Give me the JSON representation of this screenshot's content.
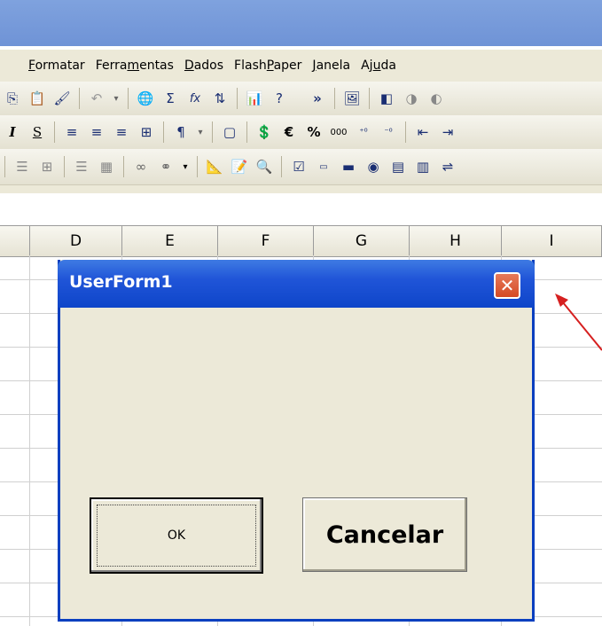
{
  "menu": {
    "items": [
      {
        "pre": "",
        "u": "F",
        "post": "ormatar"
      },
      {
        "pre": "Ferra",
        "u": "m",
        "post": "entas"
      },
      {
        "pre": "",
        "u": "D",
        "post": "ados"
      },
      {
        "pre": "Flash",
        "u": "P",
        "post": "aper"
      },
      {
        "pre": "",
        "u": "J",
        "post": "anela"
      },
      {
        "pre": "Aj",
        "u": "u",
        "post": "da"
      }
    ]
  },
  "toolbar": {
    "sigma": "Σ",
    "fx": "fx",
    "euro": "€",
    "percent": "%",
    "thousands": "000",
    "bold_i": "I",
    "underline_s": "S",
    "overflow": "»"
  },
  "columns": [
    "D",
    "E",
    "F",
    "G",
    "H",
    "I"
  ],
  "dialog": {
    "title": "UserForm1",
    "close_glyph": "✕",
    "ok_label": "OK",
    "cancel_label": "Cancelar"
  },
  "colors": {
    "dialog_title": "#1e4fd6",
    "arrow": "#d62020"
  }
}
